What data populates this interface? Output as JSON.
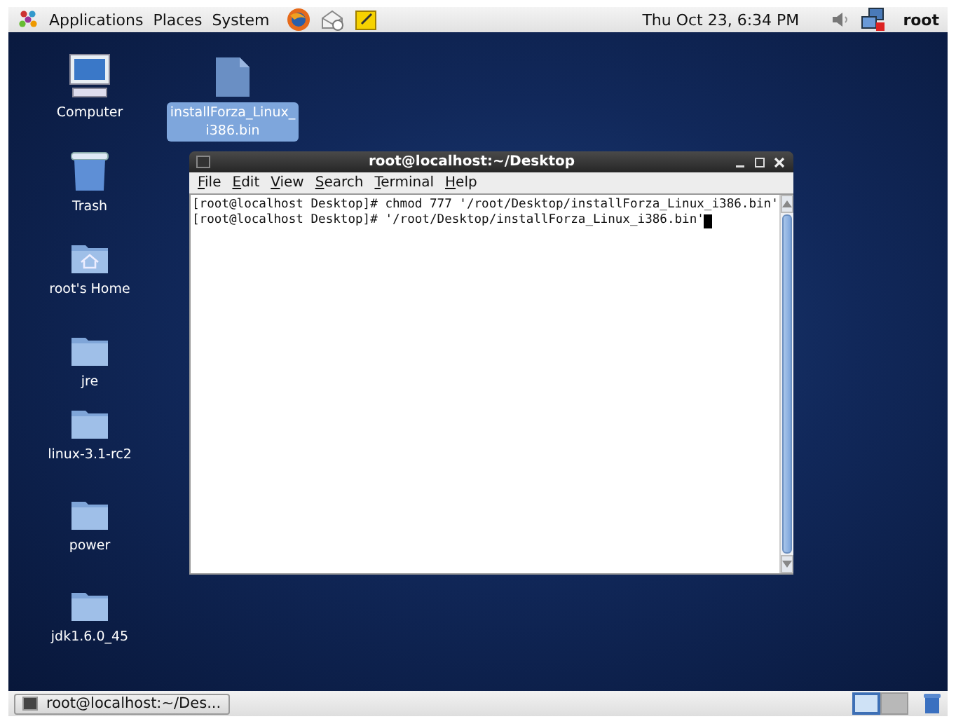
{
  "top_panel": {
    "menus": [
      "Applications",
      "Places",
      "System"
    ],
    "clock": "Thu Oct 23,  6:34 PM",
    "user": "root"
  },
  "desktop_icons": [
    {
      "kind": "computer",
      "label": "Computer",
      "selected": false
    },
    {
      "kind": "file",
      "label": "installForza_Linux_\ni386.bin",
      "selected": true
    },
    {
      "kind": "trash",
      "label": "Trash",
      "selected": false
    },
    {
      "kind": "home",
      "label": "root's Home",
      "selected": false
    },
    {
      "kind": "folder",
      "label": "jre",
      "selected": false
    },
    {
      "kind": "folder",
      "label": "linux-3.1-rc2",
      "selected": false
    },
    {
      "kind": "folder",
      "label": "power",
      "selected": false
    },
    {
      "kind": "folder",
      "label": "jdk1.6.0_45",
      "selected": false
    }
  ],
  "terminal": {
    "title": "root@localhost:~/Desktop",
    "menus": [
      "File",
      "Edit",
      "View",
      "Search",
      "Terminal",
      "Help"
    ],
    "lines": [
      "[root@localhost Desktop]# chmod 777 '/root/Desktop/installForza_Linux_i386.bin'",
      "[root@localhost Desktop]# '/root/Desktop/installForza_Linux_i386.bin'"
    ]
  },
  "bottom_panel": {
    "tasks": [
      {
        "label": "root@localhost:~/Des...",
        "selected": false
      }
    ],
    "workspaces": [
      {
        "selected": true
      },
      {
        "selected": false
      }
    ]
  }
}
